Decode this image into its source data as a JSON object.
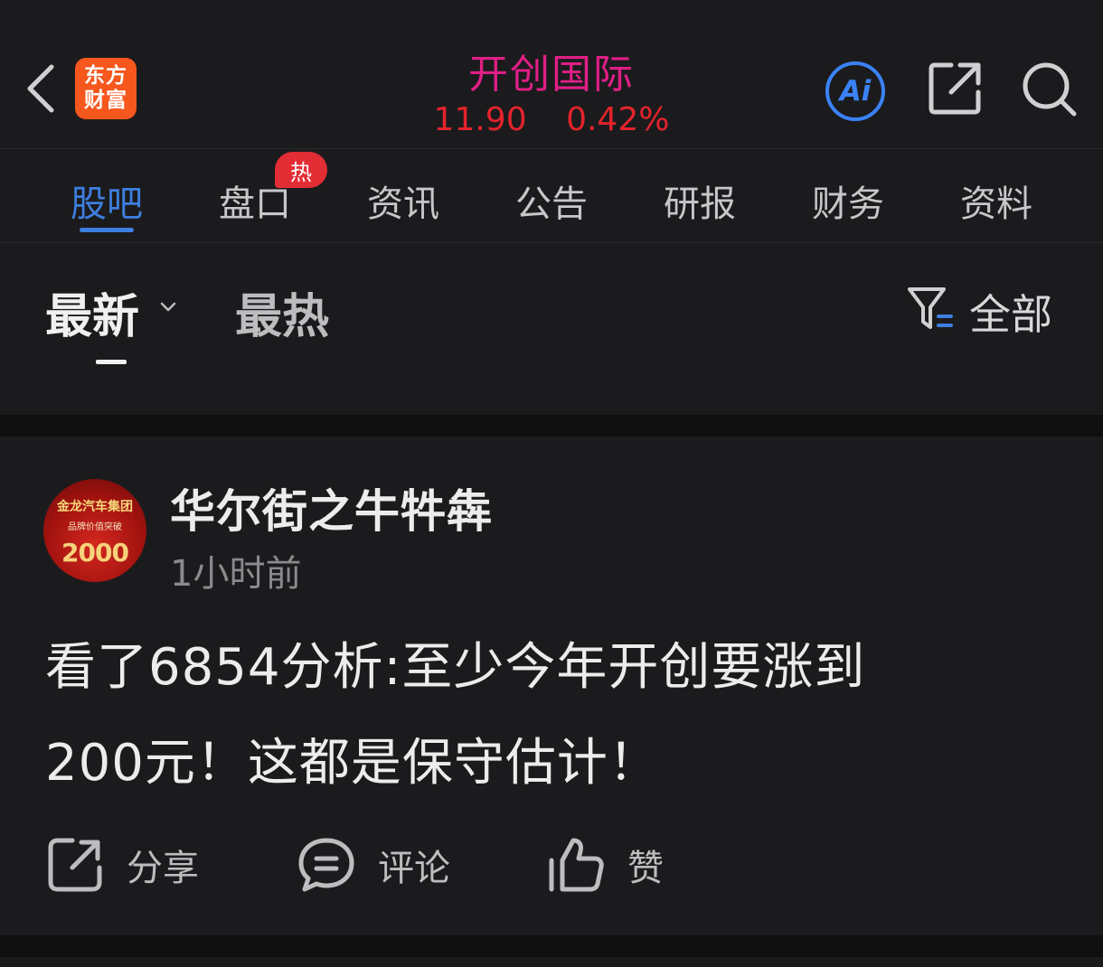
{
  "header": {
    "logo_line1": "东方",
    "logo_line2": "财富",
    "stock_name": "开创国际",
    "price": "11.90",
    "change_pct": "0.42%",
    "ai_label": "Ai",
    "icons": [
      "back-icon",
      "ai-icon",
      "share-icon",
      "search-icon"
    ],
    "quote_color": "#e3232c",
    "name_color": "#e01f86"
  },
  "tabs": {
    "items": [
      {
        "label": "股吧",
        "active": true
      },
      {
        "label": "盘口",
        "active": false
      },
      {
        "label": "资讯",
        "active": false
      },
      {
        "label": "公告",
        "active": false
      },
      {
        "label": "研报",
        "active": false
      },
      {
        "label": "财务",
        "active": false
      },
      {
        "label": "资料",
        "active": false
      }
    ],
    "hot_badge": "热",
    "accent": "#3d7fe0"
  },
  "sort": {
    "latest": "最新",
    "hot": "最热",
    "filter_label": "全部"
  },
  "post": {
    "avatar_text": {
      "line1": "金龙汽车集团",
      "line2": "品牌价值突破",
      "line3": "2000"
    },
    "author": "华尔街之牛牪犇",
    "time": "1小时前",
    "body_line1": "看了6854分析:至少今年开创要涨到",
    "body_line2": "200元！这都是保守估计！",
    "actions": {
      "share": "分享",
      "comment": "评论",
      "like": "赞"
    }
  }
}
